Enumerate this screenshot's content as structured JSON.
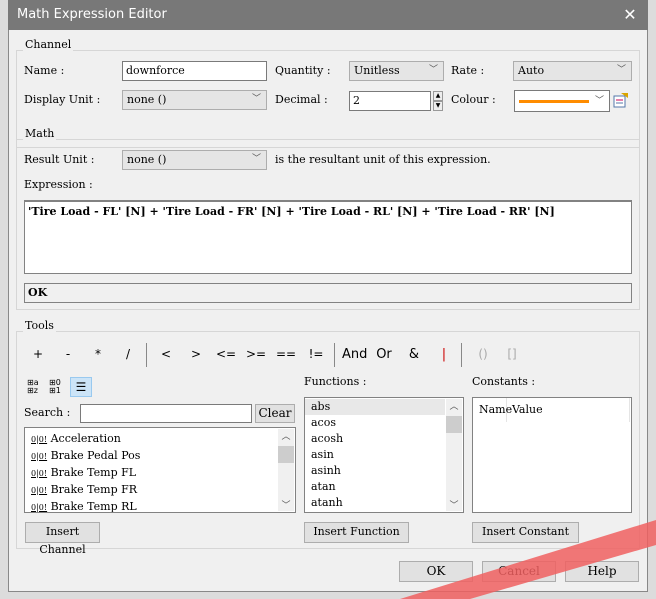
{
  "window": {
    "title": "Math Expression Editor",
    "close_icon": "close-icon"
  },
  "channel": {
    "group_label": "Channel",
    "name_label": "Name :",
    "name_value": "downforce",
    "quantity_label": "Quantity :",
    "quantity_value": "Unitless",
    "rate_label": "Rate :",
    "rate_value": "Auto",
    "display_unit_label": "Display Unit :",
    "display_unit_value": "none ()",
    "decimal_label": "Decimal :",
    "decimal_value": "2",
    "colour_label": "Colour :",
    "colour_value": "#ff8c00"
  },
  "math": {
    "group_label": "Math",
    "result_unit_label": "Result Unit :",
    "result_unit_value": "none ()",
    "result_unit_note": "is the resultant unit of this expression.",
    "expression_label": "Expression :",
    "expression_value": "'Tire Load - FL' [N] + 'Tire Load - FR' [N] + 'Tire Load - RL' [N] + 'Tire Load - RR' [N]",
    "status": "OK"
  },
  "tools": {
    "group_label": "Tools",
    "operators": [
      "+",
      "-",
      "*",
      "/",
      "<",
      ">",
      "<=",
      ">=",
      "==",
      "!=",
      "And",
      "Or",
      "&",
      "|",
      "()",
      "[]"
    ],
    "search_label": "Search :",
    "search_value": "",
    "clear_label": "Clear",
    "channels": [
      "Acceleration",
      "Brake Pedal Pos",
      "Brake Temp FL",
      "Brake Temp FR",
      "Brake Temp RL"
    ],
    "functions_label": "Functions :",
    "functions": [
      "abs",
      "acos",
      "acosh",
      "asin",
      "asinh",
      "atan",
      "atanh"
    ],
    "constants_label": "Constants :",
    "constants_columns": [
      "Name",
      "Value"
    ],
    "insert_channel": "Insert Channel",
    "insert_function": "Insert Function",
    "insert_constant": "Insert Constant"
  },
  "footer": {
    "ok": "OK",
    "cancel": "Cancel",
    "help": "Help"
  }
}
